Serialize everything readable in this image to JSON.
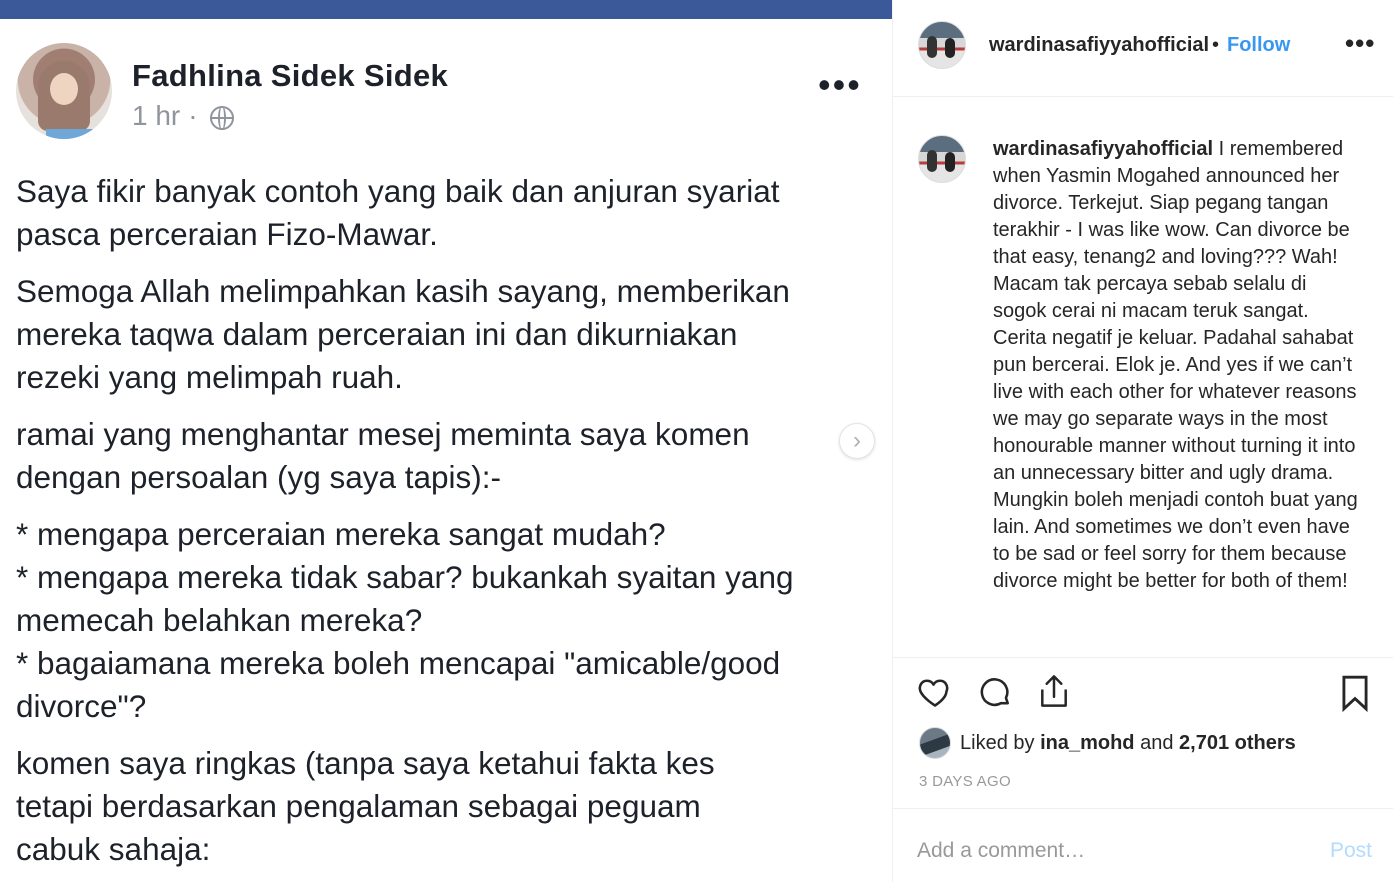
{
  "facebook_post": {
    "author_name": "Fadhlina Sidek Sidek",
    "time": "1 hr",
    "separator": "·",
    "more_label": "•••",
    "next_label": "›",
    "paragraphs": [
      "Saya fikir banyak contoh yang baik dan anjuran syariat\npasca perceraian Fizo-Mawar.",
      "Semoga Allah melimpahkan kasih sayang, memberikan\nmereka taqwa dalam perceraian ini dan dikurniakan\nrezeki yang melimpah ruah.",
      "ramai yang menghantar mesej meminta saya komen\ndengan persoalan (yg saya tapis):-",
      "* mengapa perceraian mereka sangat mudah?\n* mengapa mereka tidak sabar? bukankah syaitan yang\nmemecah belahkan mereka?\n* bagaiamana mereka boleh mencapai \"amicable/good\ndivorce\"?",
      "komen saya ringkas (tanpa saya ketahui fakta kes\ntetapi berdasarkan pengalaman sebagai peguam\ncabuk sahaja:"
    ]
  },
  "instagram": {
    "username": "wardinasafiyyahofficial",
    "dot": "•",
    "follow_label": "Follow",
    "more_label": "•••",
    "caption_username": "wardinasafiyyahofficial",
    "caption_text": " I remembered when Yasmin Mogahed announced her divorce. Terkejut. Siap pegang tangan terakhir - I was like wow. Can divorce be that easy, tenang2 and loving??? Wah! Macam tak percaya sebab selalu di sogok cerai ni macam teruk sangat. Cerita negatif je keluar. Padahal sahabat pun bercerai. Elok je. And yes if we can’t live with each other for whatever reasons we may go separate ways in the most honourable manner without turning it into an unnecessary bitter and ugly drama. Mungkin boleh menjadi contoh buat yang lain. And sometimes we don’t even have to be sad or feel sorry for them because divorce might be better for both of them!",
    "likes": {
      "prefix": "Liked by ",
      "user": "ina_mohd",
      "middle": " and ",
      "others": "2,701 others"
    },
    "timestamp": "3 DAYS AGO",
    "comment_placeholder": "Add a comment…",
    "post_label": "Post"
  },
  "colors": {
    "facebook_blue": "#3b5998",
    "instagram_link": "#3897f0",
    "post_disabled": "#b3dbff"
  },
  "icons": [
    "globe-icon",
    "heart-icon",
    "comment-icon",
    "share-icon",
    "bookmark-icon",
    "chevron-right-icon",
    "more-icon"
  ]
}
